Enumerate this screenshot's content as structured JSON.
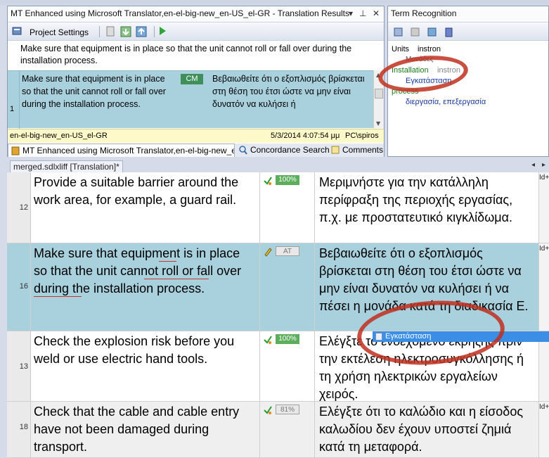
{
  "translation_results": {
    "title": "MT Enhanced using Microsoft Translator,en-el-big-new_en-US_el-GR - Translation Results",
    "toolbar": {
      "project_settings": "Project Settings"
    },
    "source_line": "Make sure that equipment is in place so that the unit cannot roll or fall over during the installation process.",
    "match": {
      "number": "1",
      "source": "Make sure that equipment is in place so that the unit cannot roll or fall over during the installation process.",
      "badge": "CM",
      "target": "Βεβαιωθείτε ότι ο εξοπλισμός βρίσκεται στη θέση του έτσι ώστε να μην είναι δυνατόν να κυλήσει ή"
    },
    "status": {
      "tm_name": "en-el-big-new_en-US_el-GR",
      "date": "5/3/2014 4:07:54 μμ",
      "user": "PC\\spiros"
    },
    "tabs": [
      {
        "label": "MT Enhanced using Microsoft Translator,en-el-big-new_e..."
      },
      {
        "label": "Concordance Search"
      },
      {
        "label": "Comments"
      }
    ]
  },
  "term_recognition": {
    "title": "Term Recognition",
    "entries": [
      {
        "source": "Units",
        "target": "instron"
      },
      {
        "source": "",
        "target": "Μονάδες"
      },
      {
        "source": "Installation",
        "target": "instron"
      },
      {
        "source": "",
        "target": "Εγκατάσταση"
      },
      {
        "source": "process",
        "target": ""
      },
      {
        "source": "",
        "target": "διεργασία, επεξεργασία"
      }
    ]
  },
  "editor": {
    "tab_label": "merged.sdlxliff [Translation]*",
    "rows": [
      {
        "num": "12",
        "source": "Provide a suitable barrier around the work area, for example, a guard rail.",
        "match": "100%",
        "target": "Μεριμνήστε για την κατάλληλη περίφραξη της περιοχής εργασίας, π.χ. με προστατευτικό κιγκλίδωμα.",
        "id": "Id+"
      },
      {
        "num": "16",
        "source": "Make sure that equipment is in place so that the unit cannot roll or fall over during the installation process.",
        "match": "AT",
        "target": "Βεβαιωθείτε ότι ο εξοπλισμός βρίσκεται στη θέση του έτσι ώστε να μην είναι δυνατόν να κυλήσει ή να πέσει η μονάδα κατά τη διαδικασία  Ε.",
        "id": "Id+"
      },
      {
        "num": "13",
        "source": "Check the explosion risk before you weld or use electric hand tools.",
        "match": "100%",
        "target": "Ελέγξτε το ενδεχόμενο έκρηξης πριν την εκτέλεση ηλεκτροσυγκόλλησης ή τη χρήση ηλεκτρικών εργαλείων χειρός.",
        "id": "Id+"
      },
      {
        "num": "18",
        "source": "Check that the cable and cable entry have not been damaged during transport.",
        "match": "81%",
        "target": "Ελέγξτε ότι το καλώδιο και η είσοδος καλωδίου δεν έχουν υποστεί ζημιά κατά τη μεταφορά.",
        "id": "Id+"
      }
    ],
    "autocomplete": "Εγκατάσταση"
  },
  "colors": {
    "active_row": "#a9d0dd",
    "annotation": "#c0301e",
    "autocomplete": "#3a8ee6"
  }
}
